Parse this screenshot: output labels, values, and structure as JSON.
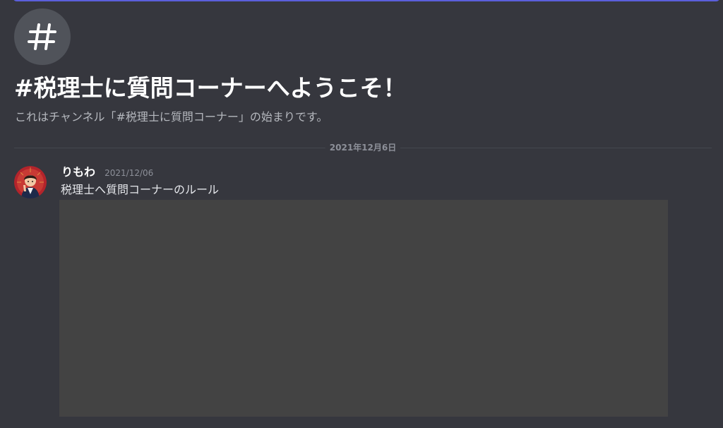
{
  "channel": {
    "icon": "hash-icon",
    "welcome_title": "#税理士に質問コーナーへようこそ！",
    "welcome_description": "これはチャンネル「#税理士に質問コーナー」の始まりです。"
  },
  "divider": {
    "date_label": "2021年12月6日"
  },
  "message": {
    "author": "りもわ",
    "timestamp": "2021/12/06",
    "text": "税理士へ質問コーナーのルール",
    "avatar_icon": "user-avatar-icon",
    "attachment_icon": "image-attachment-icon"
  },
  "colors": {
    "background": "#36373e",
    "accent": "#5b5fdc",
    "icon_circle": "#50535a",
    "attachment": "#434343"
  }
}
